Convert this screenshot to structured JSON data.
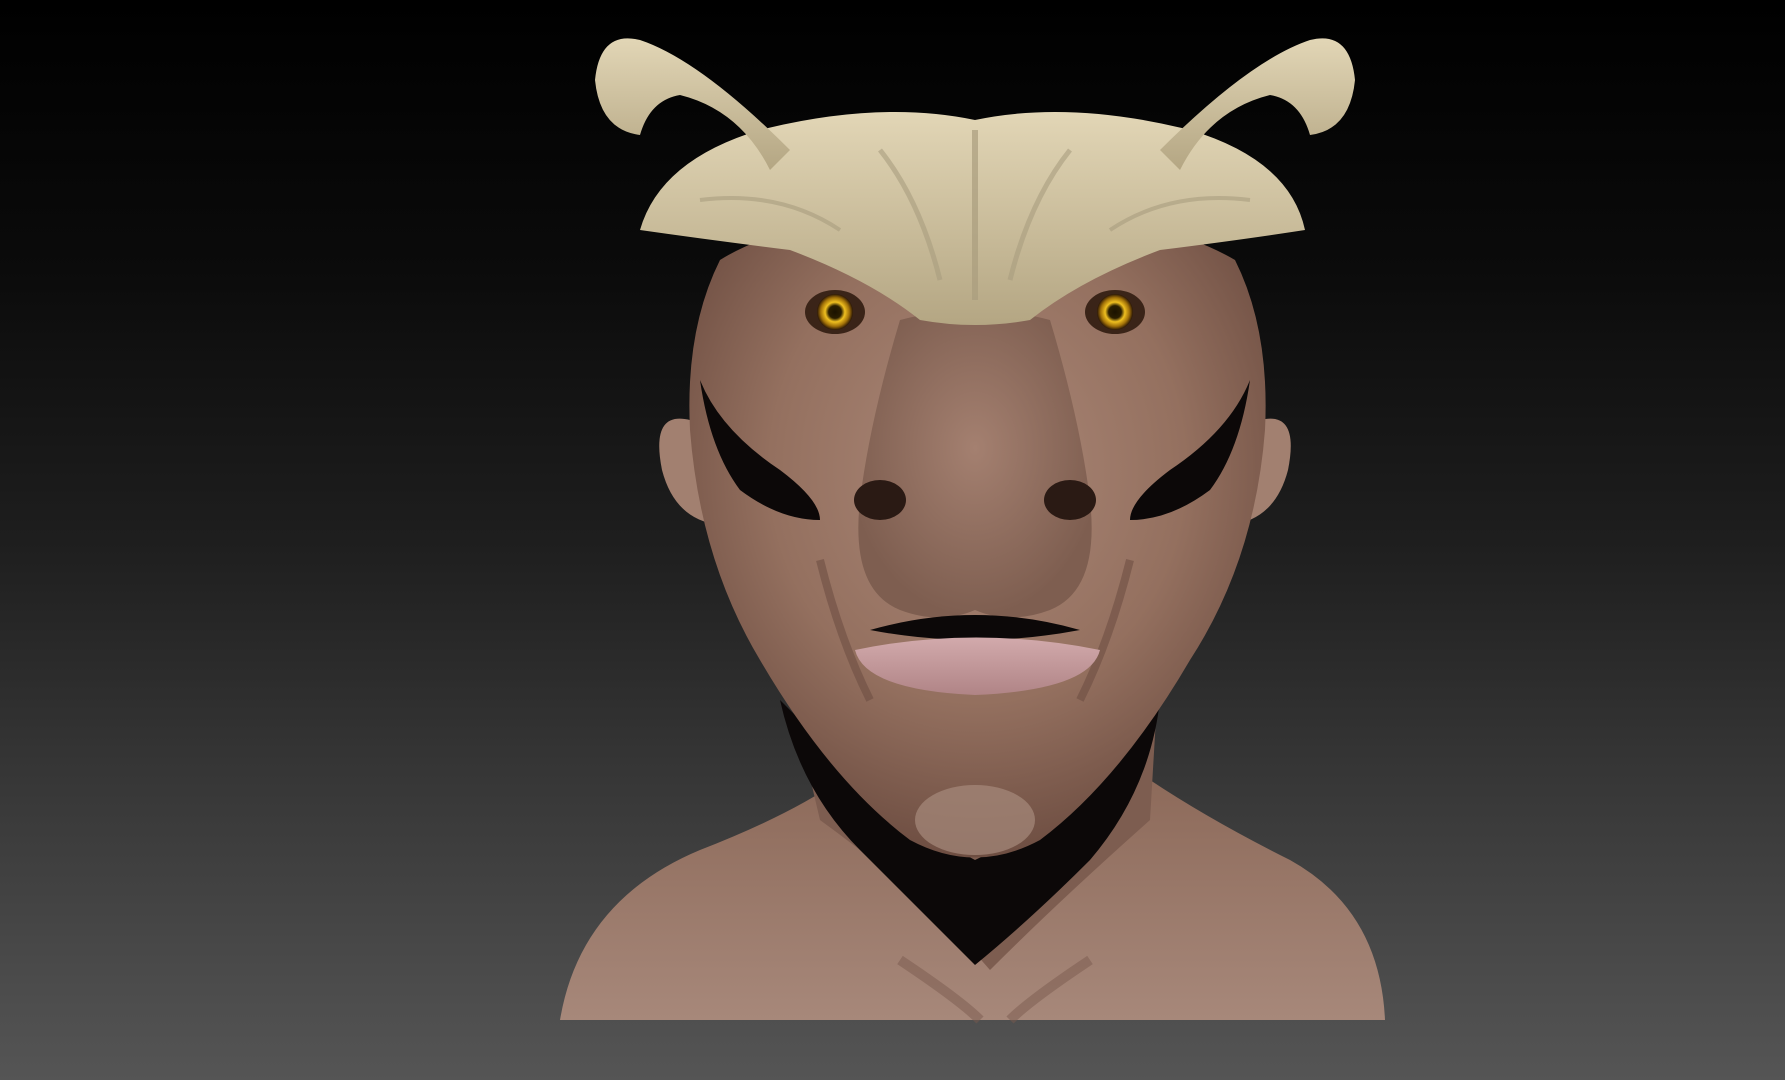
{
  "scene": {
    "subject": "sculpted-creature-bust-render",
    "background_top_color": "#000000",
    "background_bottom_color": "#555555",
    "skin_color": "#9c7a6a",
    "skin_shadow_color": "#6e4e42",
    "horn_color": "#d9ccab",
    "horn_shadow_color": "#a99c7e",
    "eye_color": "#e0b020",
    "lip_color": "#c49a9c",
    "dark_patch_color": "#0c0808"
  }
}
